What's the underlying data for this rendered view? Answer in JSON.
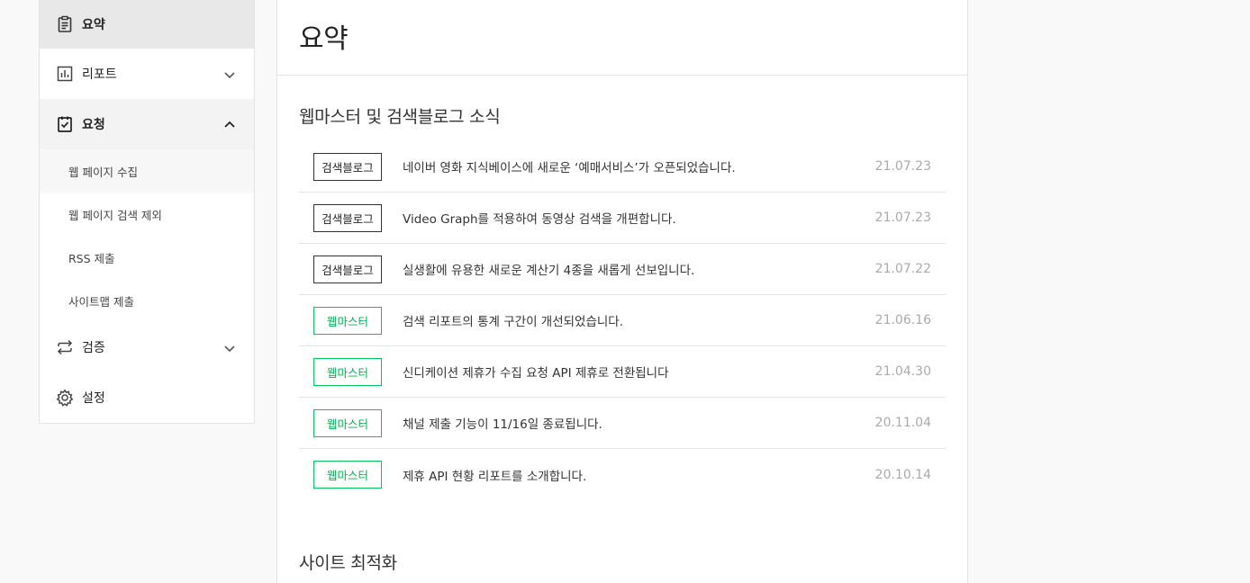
{
  "sidebar": {
    "items": [
      {
        "label": "요약"
      },
      {
        "label": "리포트"
      },
      {
        "label": "요청"
      },
      {
        "label": "검증"
      },
      {
        "label": "설정"
      }
    ],
    "sub_items": [
      {
        "label": "웹 페이지 수집"
      },
      {
        "label": "웹 페이지 검색 제외"
      },
      {
        "label": "RSS 제출"
      },
      {
        "label": "사이트맵 제출"
      }
    ]
  },
  "main": {
    "title": "요약",
    "news_section": {
      "title": "웹마스터 및 검색블로그 소식",
      "rows": [
        {
          "badge": "검색블로그",
          "text": "네이버 영화 지식베이스에 새로운 ‘예매서비스’가 오픈되었습니다.",
          "date": "21.07.23"
        },
        {
          "badge": "검색블로그",
          "text": "Video Graph를 적용하여 동영상 검색을 개편합니다.",
          "date": "21.07.23"
        },
        {
          "badge": "검색블로그",
          "text": "실생활에 유용한 새로운 계산기 4종을 새롭게 선보입니다.",
          "date": "21.07.22"
        },
        {
          "badge": "웹마스터",
          "text": "검색 리포트의 통계 구간이 개선되었습니다.",
          "date": "21.06.16"
        },
        {
          "badge": "웹마스터",
          "text": "신디케이션 제휴가 수집 요청 API 제휴로 전환됩니다",
          "date": "21.04.30"
        },
        {
          "badge": "웹마스터",
          "text": "채널 제출 기능이 11/16일 종료됩니다.",
          "date": "20.11.04"
        },
        {
          "badge": "웹마스터",
          "text": "제휴 API 현황 리포트를 소개합니다.",
          "date": "20.10.14"
        }
      ]
    },
    "optimization_section": {
      "title": "사이트 최적화"
    }
  },
  "colors": {
    "accent_green": "#03c75a",
    "active_bg": "#e8e8e8"
  }
}
